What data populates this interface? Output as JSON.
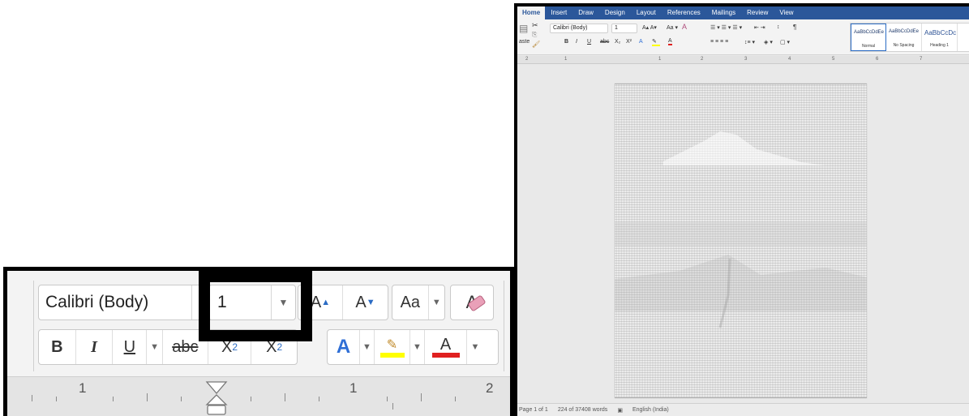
{
  "zoom": {
    "font_name": "Calibri (Body)",
    "font_size": "1",
    "grow_font_label": "A",
    "shrink_font_label": "A",
    "change_case_label": "Aa",
    "clear_format_label": "A",
    "bold_label": "B",
    "italic_label": "I",
    "underline_label": "U",
    "strike_label": "abc",
    "subscript_label": "X",
    "subscript_sub": "2",
    "superscript_label": "X",
    "superscript_sup": "2",
    "text_effects_label": "A",
    "font_color_label": "A",
    "ruler_labels": [
      "1",
      "1",
      "2"
    ],
    "colors": {
      "highlight": "#ffff00",
      "font_color": "#e02020",
      "effects": "#2f6fd6"
    }
  },
  "word": {
    "tabs": [
      "Home",
      "Insert",
      "Draw",
      "Design",
      "Layout",
      "References",
      "Mailings",
      "Review",
      "View"
    ],
    "active_tab": "Home",
    "paste_label": "aste",
    "font_name": "Calibri (Body)",
    "font_size": "1",
    "styles": [
      {
        "preview": "AaBbCcDdEe",
        "name": "Normal"
      },
      {
        "preview": "AaBbCcDdEe",
        "name": "No Spacing"
      },
      {
        "preview": "AaBbCcDc",
        "name": "Heading 1"
      }
    ],
    "ruler_labels": [
      "2",
      "1",
      "1",
      "2",
      "3",
      "4",
      "5",
      "6",
      "7"
    ],
    "status": {
      "page": "Page 1 of 1",
      "words": "224 of 37408 words",
      "language": "English (India)"
    },
    "accent": "#2b579a"
  }
}
